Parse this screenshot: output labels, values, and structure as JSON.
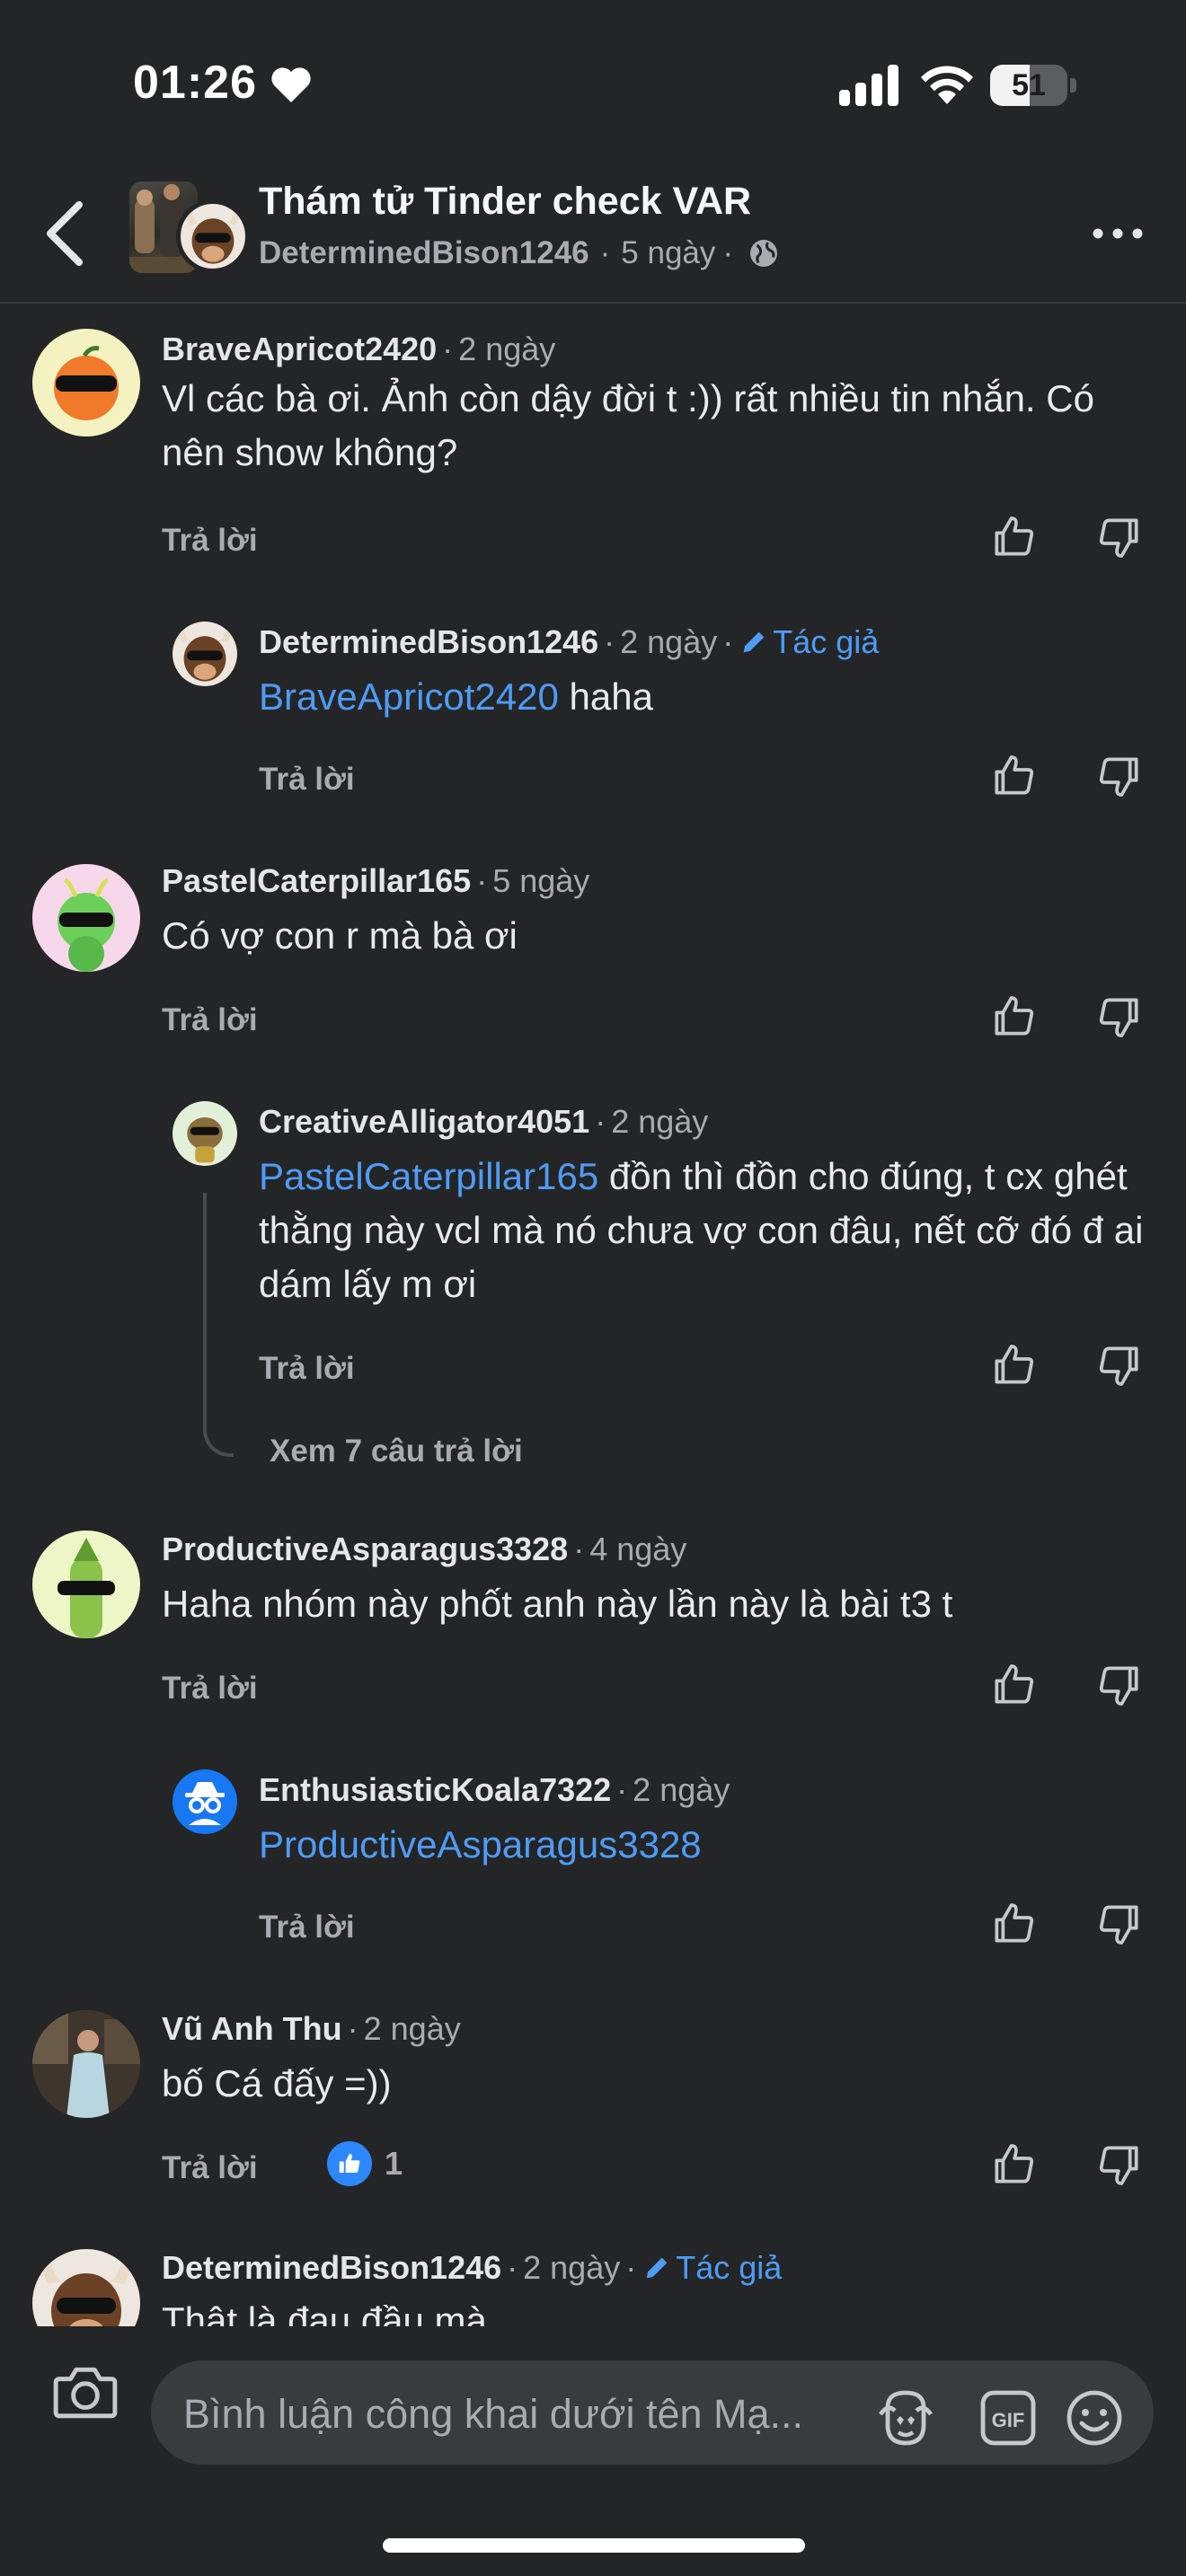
{
  "status_bar": {
    "time": "01:26",
    "battery": "51",
    "battery_level": 0.51
  },
  "header": {
    "title": "Thám tử Tinder check VAR",
    "author": "DeterminedBison1246",
    "age": "5 ngày"
  },
  "common": {
    "reply_label": "Trả lời",
    "author_badge": "Tác giả",
    "dot": "·"
  },
  "comments": [
    {
      "name": "BraveApricot2420",
      "age": "2 ngày",
      "text": "Vl các bà ơi. Ảnh còn dậy đời t :)) rất nhiều tin nhắn. Có nên show không?"
    },
    {
      "name": "DeterminedBison1246",
      "age": "2 ngày",
      "mention": "BraveApricot2420",
      "text": " haha"
    },
    {
      "name": "PastelCaterpillar165",
      "age": "5 ngày",
      "text": "Có vợ con r mà bà ơi"
    },
    {
      "name": "CreativeAlligator4051",
      "age": "2 ngày",
      "mention": "PastelCaterpillar165",
      "text": " đồn thì đồn cho đúng, t cx ghét thằng này vcl mà nó chưa vợ con đâu,  nết cỡ đó đ ai dám lấy m ơi",
      "view_replies": "Xem 7 câu trả lời"
    },
    {
      "name": "ProductiveAsparagus3328",
      "age": "4 ngày",
      "text": "Haha nhóm này phốt anh này lần này là bài t3 t"
    },
    {
      "name": "EnthusiasticKoala7322",
      "age": "2 ngày",
      "mention": "ProductiveAsparagus3328",
      "text": ""
    },
    {
      "name": "Vũ Anh Thu",
      "age": "2 ngày",
      "text": "bố Cá đấy =))",
      "likes": "1"
    },
    {
      "name": "DeterminedBison1246",
      "age": "2 ngày",
      "text": "Thật là đau đầu mà"
    }
  ],
  "composer": {
    "placeholder": "Bình luận công khai dưới tên Mạ..."
  },
  "colors": {
    "background": "#242526",
    "accent": "#4f9cf9",
    "muted": "#a8abb0"
  }
}
